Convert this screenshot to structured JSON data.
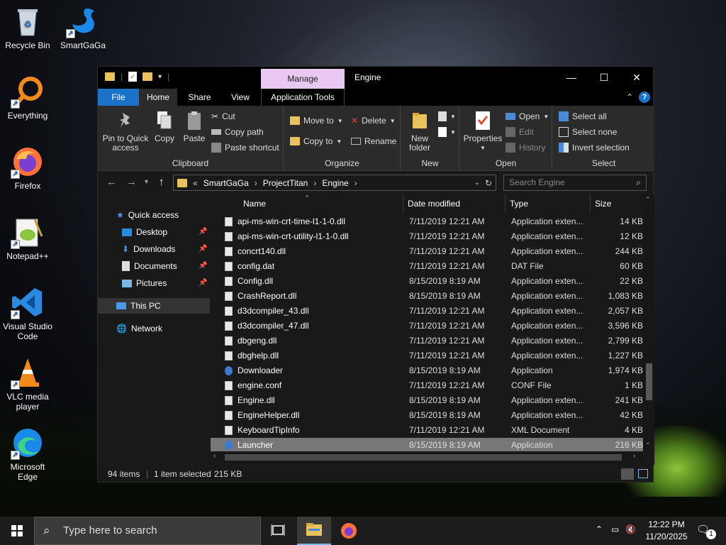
{
  "desktop": {
    "icons": [
      {
        "label": "Recycle Bin"
      },
      {
        "label": "SmartGaGa"
      },
      {
        "label": "Everything"
      },
      {
        "label": "Firefox"
      },
      {
        "label": "Notepad++"
      },
      {
        "label": "Visual Studio Code"
      },
      {
        "label": "VLC media player"
      },
      {
        "label": "Microsoft Edge"
      }
    ]
  },
  "window": {
    "title": "Engine",
    "context_tab": "Manage",
    "tabs": {
      "file": "File",
      "home": "Home",
      "share": "Share",
      "view": "View",
      "app_tools": "Application Tools"
    }
  },
  "ribbon": {
    "clipboard": {
      "label": "Clipboard",
      "pin": "Pin to Quick access",
      "copy": "Copy",
      "paste": "Paste",
      "cut": "Cut",
      "copy_path": "Copy path",
      "paste_shortcut": "Paste shortcut"
    },
    "organize": {
      "label": "Organize",
      "move_to": "Move to",
      "copy_to": "Copy to",
      "delete": "Delete",
      "rename": "Rename"
    },
    "new": {
      "label": "New",
      "new_folder": "New folder"
    },
    "open": {
      "label": "Open",
      "properties": "Properties",
      "open": "Open",
      "edit": "Edit",
      "history": "History"
    },
    "select": {
      "label": "Select",
      "select_all": "Select all",
      "select_none": "Select none",
      "invert": "Invert selection"
    }
  },
  "address": {
    "crumbs": [
      "SmartGaGa",
      "ProjectTitan",
      "Engine"
    ],
    "search_placeholder": "Search Engine"
  },
  "navpane": {
    "quick_access": "Quick access",
    "items": [
      "Desktop",
      "Downloads",
      "Documents",
      "Pictures"
    ],
    "this_pc": "This PC",
    "network": "Network"
  },
  "columns": {
    "name": "Name",
    "date": "Date modified",
    "type": "Type",
    "size": "Size"
  },
  "files": [
    {
      "name": "api-ms-win-crt-time-l1-1-0.dll",
      "date": "7/11/2019 12:21 AM",
      "type": "Application exten...",
      "size": "14 KB",
      "kind": "dll"
    },
    {
      "name": "api-ms-win-crt-utility-l1-1-0.dll",
      "date": "7/11/2019 12:21 AM",
      "type": "Application exten...",
      "size": "12 KB",
      "kind": "dll"
    },
    {
      "name": "concrt140.dll",
      "date": "7/11/2019 12:21 AM",
      "type": "Application exten...",
      "size": "244 KB",
      "kind": "dll"
    },
    {
      "name": "config.dat",
      "date": "7/11/2019 12:21 AM",
      "type": "DAT File",
      "size": "60 KB",
      "kind": "file"
    },
    {
      "name": "Config.dll",
      "date": "8/15/2019 8:19 AM",
      "type": "Application exten...",
      "size": "22 KB",
      "kind": "dll"
    },
    {
      "name": "CrashReport.dll",
      "date": "8/15/2019 8:19 AM",
      "type": "Application exten...",
      "size": "1,083 KB",
      "kind": "dll"
    },
    {
      "name": "d3dcompiler_43.dll",
      "date": "7/11/2019 12:21 AM",
      "type": "Application exten...",
      "size": "2,057 KB",
      "kind": "dll"
    },
    {
      "name": "d3dcompiler_47.dll",
      "date": "7/11/2019 12:21 AM",
      "type": "Application exten...",
      "size": "3,596 KB",
      "kind": "dll"
    },
    {
      "name": "dbgeng.dll",
      "date": "7/11/2019 12:21 AM",
      "type": "Application exten...",
      "size": "2,799 KB",
      "kind": "dll"
    },
    {
      "name": "dbghelp.dll",
      "date": "7/11/2019 12:21 AM",
      "type": "Application exten...",
      "size": "1,227 KB",
      "kind": "dll"
    },
    {
      "name": "Downloader",
      "date": "8/15/2019 8:19 AM",
      "type": "Application",
      "size": "1,974 KB",
      "kind": "app"
    },
    {
      "name": "engine.conf",
      "date": "7/11/2019 12:21 AM",
      "type": "CONF File",
      "size": "1 KB",
      "kind": "file"
    },
    {
      "name": "Engine.dll",
      "date": "8/15/2019 8:19 AM",
      "type": "Application exten...",
      "size": "241 KB",
      "kind": "dll"
    },
    {
      "name": "EngineHelper.dll",
      "date": "8/15/2019 8:19 AM",
      "type": "Application exten...",
      "size": "42 KB",
      "kind": "dll"
    },
    {
      "name": "KeyboardTipInfo",
      "date": "7/11/2019 12:21 AM",
      "type": "XML Document",
      "size": "4 KB",
      "kind": "file"
    },
    {
      "name": "Launcher",
      "date": "8/15/2019 8:19 AM",
      "type": "Application",
      "size": "216 KB",
      "kind": "app",
      "selected": true
    }
  ],
  "status": {
    "items": "94 items",
    "selected": "1 item selected",
    "size": "215 KB"
  },
  "taskbar": {
    "search_placeholder": "Type here to search",
    "time": "12:22 PM",
    "date": "11/20/2025",
    "notifications": "1"
  },
  "colors": {
    "accent": "#1a73c8",
    "manage_tab": "#e8c8f0",
    "folder": "#e8c25a",
    "selected_row": "#777777"
  }
}
